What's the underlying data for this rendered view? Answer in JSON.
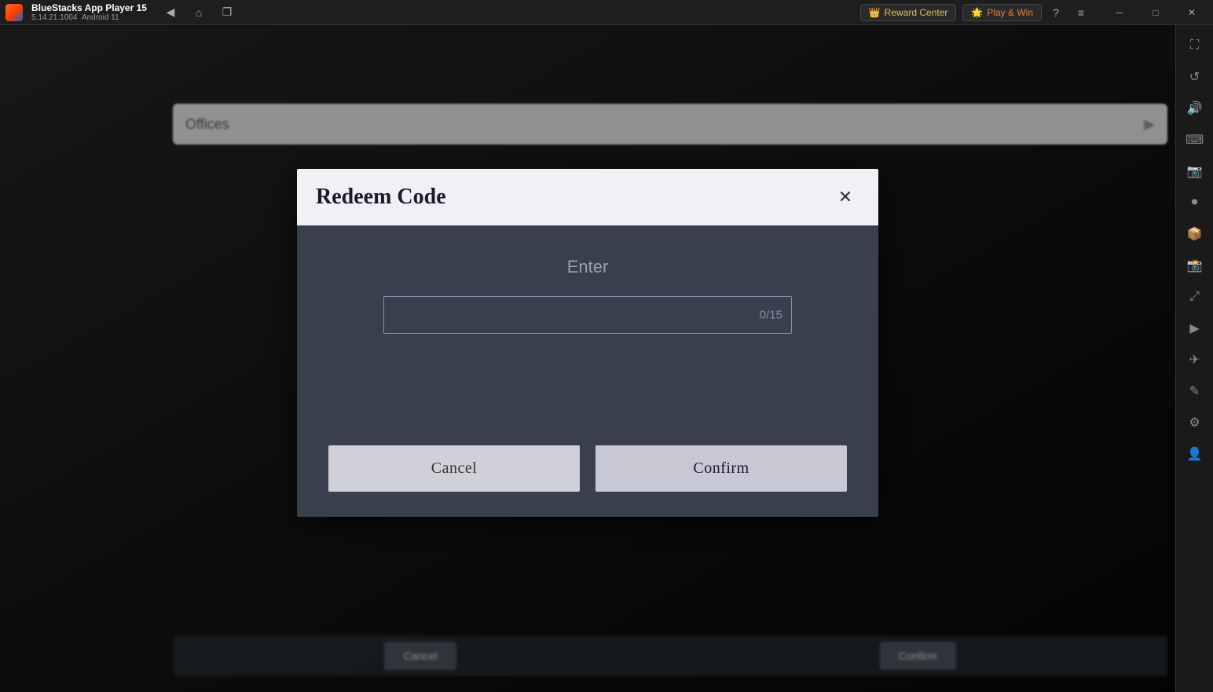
{
  "titlebar": {
    "app_name": "BlueStacks App Player 15",
    "app_version": "5.14.21.1004",
    "android_version": "Android 11",
    "reward_center_label": "Reward Center",
    "play_win_label": "Play & Win",
    "nav_back_icon": "◀",
    "nav_home_icon": "⌂",
    "nav_copy_icon": "❐",
    "help_icon": "?",
    "menu_icon": "≡",
    "minimize_icon": "─",
    "maximize_icon": "□",
    "close_icon": "✕",
    "fullscreen_icon": "⛶"
  },
  "sidebar": {
    "icons": [
      {
        "name": "fullscreen-icon",
        "symbol": "⛶"
      },
      {
        "name": "rotate-icon",
        "symbol": "↺"
      },
      {
        "name": "volume-icon",
        "symbol": "♪"
      },
      {
        "name": "keyboard-icon",
        "symbol": "⌨"
      },
      {
        "name": "screenshot-icon",
        "symbol": "📷"
      },
      {
        "name": "record-icon",
        "symbol": "⏺"
      },
      {
        "name": "apk-icon",
        "symbol": "📦"
      },
      {
        "name": "camera-icon",
        "symbol": "📸"
      },
      {
        "name": "resize-icon",
        "symbol": "⤢"
      },
      {
        "name": "macro-icon",
        "symbol": "▶"
      },
      {
        "name": "fly-icon",
        "symbol": "✈"
      },
      {
        "name": "edit-icon",
        "symbol": "✎"
      },
      {
        "name": "settings-icon",
        "symbol": "⚙"
      },
      {
        "name": "profile-icon",
        "symbol": "👤"
      }
    ]
  },
  "modal": {
    "title": "Redeem Code",
    "close_icon": "✕",
    "enter_label": "Enter",
    "input_placeholder": "",
    "input_counter": "0/15",
    "cancel_label": "Cancel",
    "confirm_label": "Confirm"
  },
  "game_ui": {
    "topbar_text": "Offices",
    "bottom_buttons": [
      "Cancel",
      "Confirm"
    ]
  }
}
